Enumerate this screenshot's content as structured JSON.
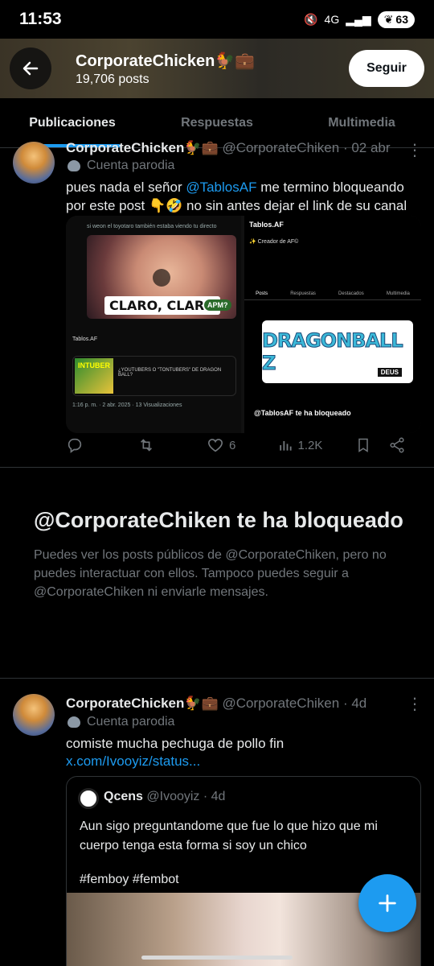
{
  "status_bar": {
    "time": "11:53",
    "network": "4G",
    "battery": "63"
  },
  "header": {
    "name": "CorporateChicken🐓💼",
    "posts": "19,706 posts",
    "follow_label": "Seguir"
  },
  "tabs": [
    {
      "label": "Publicaciones"
    },
    {
      "label": "Respuestas"
    },
    {
      "label": "Multimedia"
    }
  ],
  "tweet1": {
    "display_name": "CorporateChicken🐓💼",
    "handle": "@CorporateChiken",
    "time": "· 02 abr",
    "parody_label": "Cuenta parodia",
    "text_prefix": "pues nada el señor ",
    "mention": "@TablosAF",
    "text_suffix": " me termino bloqueando",
    "text_line2": "por este post 👇🤣 no sin antes dejar el link de su canal",
    "media": {
      "left_header": "si weon el toyotaro también estaba viendo tu directo",
      "caption": "CLARO, CLARO",
      "badge": "APM?",
      "card_title": "¿YOUTUBERS O \"TONTUBERS\" DE DRAGON BALL?",
      "card_label": "INTUBER",
      "timestamp_mini": "1:16 p. m. · 2 abr. 2025 · 13 Visualizaciones",
      "profile_name": "Tablos.AF",
      "profile_bio": "✨ Creador de AF©",
      "profile_tabs": [
        "Posts",
        "Respuestas",
        "Destacados",
        "Multimedia"
      ],
      "logo_text": "DRAGONBALL Z",
      "logo_sub": "DEUS",
      "blocked_text": "@TablosAF te ha bloqueado"
    },
    "actions": {
      "reply": "",
      "retweet": "",
      "likes": "6",
      "views": "1.2K"
    }
  },
  "blocked_notice": {
    "title": "@CorporateChiken te ha bloqueado",
    "description": "Puedes ver los posts públicos de @CorporateChiken, pero no puedes interactuar con ellos. Tampoco puedes seguir a @CorporateChiken ni enviarle mensajes."
  },
  "tweet2": {
    "display_name": "CorporateChicken🐓💼",
    "handle": "@CorporateChiken",
    "time": "· 4d",
    "parody_label": "Cuenta parodia",
    "text": "comiste mucha pechuga de pollo fin",
    "link": "x.com/Ivooyiz/status...",
    "quote": {
      "name": "Qcens",
      "handle": "@Ivooyiz",
      "time": "· 4d",
      "text_line1": "Aun sigo preguntandome que fue lo que hizo que mi cuerpo tenga esta forma si soy un chico",
      "hashtags": "#femboy #fembot"
    }
  },
  "colors": {
    "accent": "#1d9bf0",
    "background": "#000000",
    "muted": "#71767b",
    "text": "#e7e9ea"
  }
}
